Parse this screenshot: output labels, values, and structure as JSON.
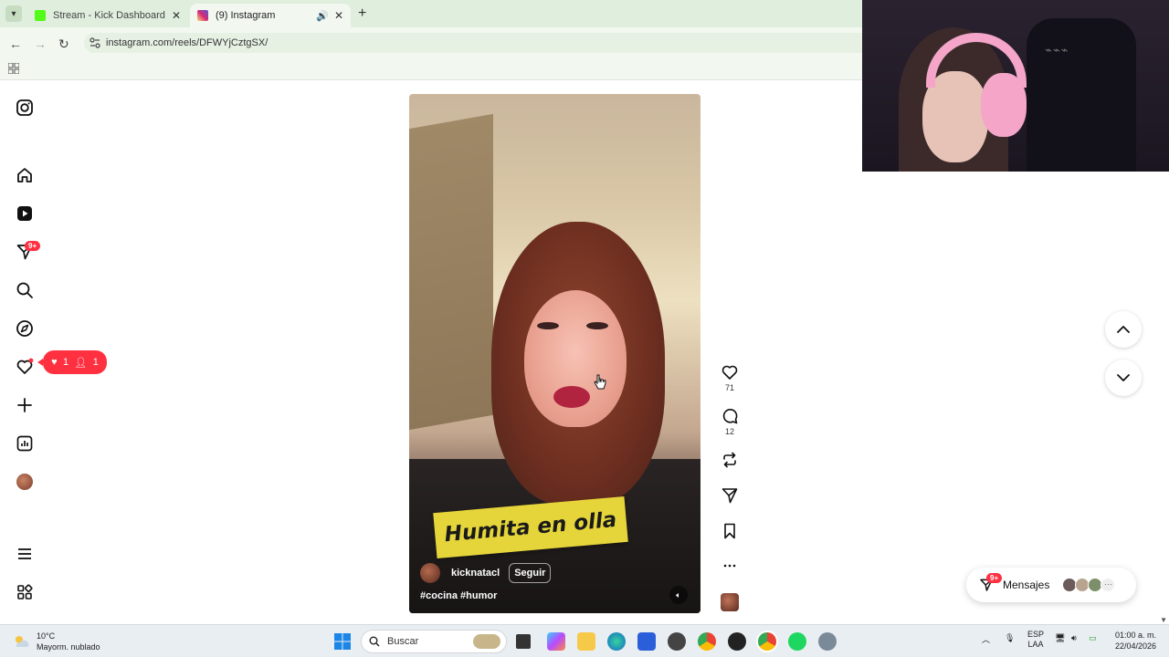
{
  "browser": {
    "tabs": [
      {
        "title": "Stream - Kick Dashboard",
        "favicon_color": "#53fc18"
      },
      {
        "title": "(9) Instagram",
        "favicon_color": "#d62976"
      }
    ],
    "url": "instagram.com/reels/DFWYjCztgSX/"
  },
  "instagram": {
    "sidebar": {
      "notifications_badge": "9+",
      "activity_pill": {
        "likes": "1",
        "follows": "1"
      }
    },
    "reel": {
      "caption_banner": "Humita en olla",
      "username": "kicknatacl",
      "follow_label": "Seguir",
      "hashtags": "#cocina #humor"
    },
    "actions": {
      "likes": "71",
      "comments": "12"
    },
    "messages": {
      "label": "Mensajes",
      "badge": "9+"
    }
  },
  "taskbar": {
    "weather_temp": "10°C",
    "weather_desc": "Mayorm. nublado",
    "search_placeholder": "Buscar",
    "lang_top": "ESP",
    "lang_bottom": "LAA",
    "time": "01:00 a. m.",
    "date": "22/04/2026"
  },
  "colors": {
    "accent": "#ff3040",
    "chrome_bg": "#dfeedd",
    "banner": "#e5d53a"
  }
}
